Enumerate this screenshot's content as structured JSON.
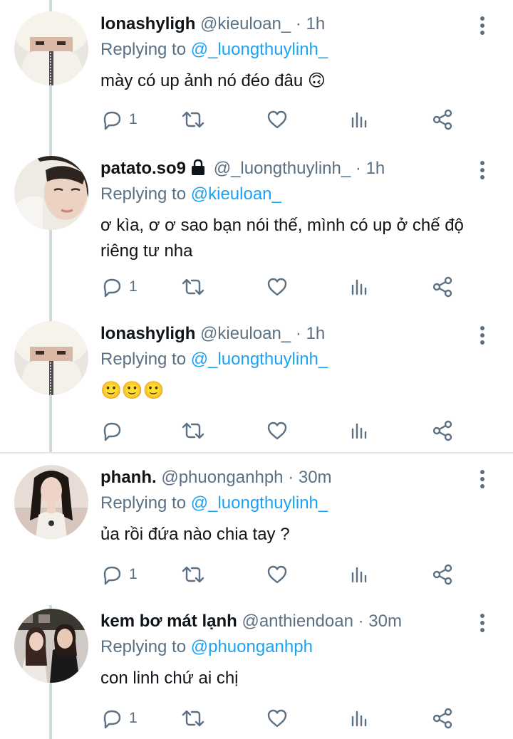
{
  "tweets": [
    {
      "name": "lonashyligh",
      "locked": false,
      "handle": "@kieuloan_",
      "separator": "·",
      "time": "1h",
      "replying_label": "Replying to",
      "replying_to": "@_luongthuylinh_",
      "text": "mày có up ảnh nó đéo đâu 🙃",
      "reply_count": "1",
      "icon": "avatar-white-hat"
    },
    {
      "name": "patato.so9",
      "locked": true,
      "handle": "@_luongthuylinh_",
      "separator": "·",
      "time": "1h",
      "replying_label": "Replying to",
      "replying_to": "@kieuloan_",
      "text": "ơ kìa, ơ ơ sao bạn nói thế, mình có up ở chế độ riêng tư nha",
      "reply_count": "1",
      "icon": "avatar-girl-selfie"
    },
    {
      "name": "lonashyligh",
      "locked": false,
      "handle": "@kieuloan_",
      "separator": "·",
      "time": "1h",
      "replying_label": "Replying to",
      "replying_to": "@_luongthuylinh_",
      "text": "🙂🙂🙂",
      "reply_count": "",
      "icon": "avatar-white-hat"
    },
    {
      "name": "phanh.",
      "locked": false,
      "handle": "@phuonganhph",
      "separator": "·",
      "time": "30m",
      "replying_label": "Replying to",
      "replying_to": "@_luongthuylinh_",
      "text": "ủa rồi đứa nào chia tay ?",
      "reply_count": "1",
      "icon": "avatar-dark-hair"
    },
    {
      "name": "kem bơ mát lạnh",
      "locked": false,
      "handle": "@anthiendoan",
      "separator": "·",
      "time": "30m",
      "replying_label": "Replying to",
      "replying_to": "@phuonganhph",
      "text": "con linh chứ ai chị",
      "reply_count": "1",
      "icon": "avatar-two-people"
    }
  ],
  "colors": {
    "link": "#1da1f2",
    "secondary": "#5b7083",
    "thread_line": "#cfd9de"
  }
}
